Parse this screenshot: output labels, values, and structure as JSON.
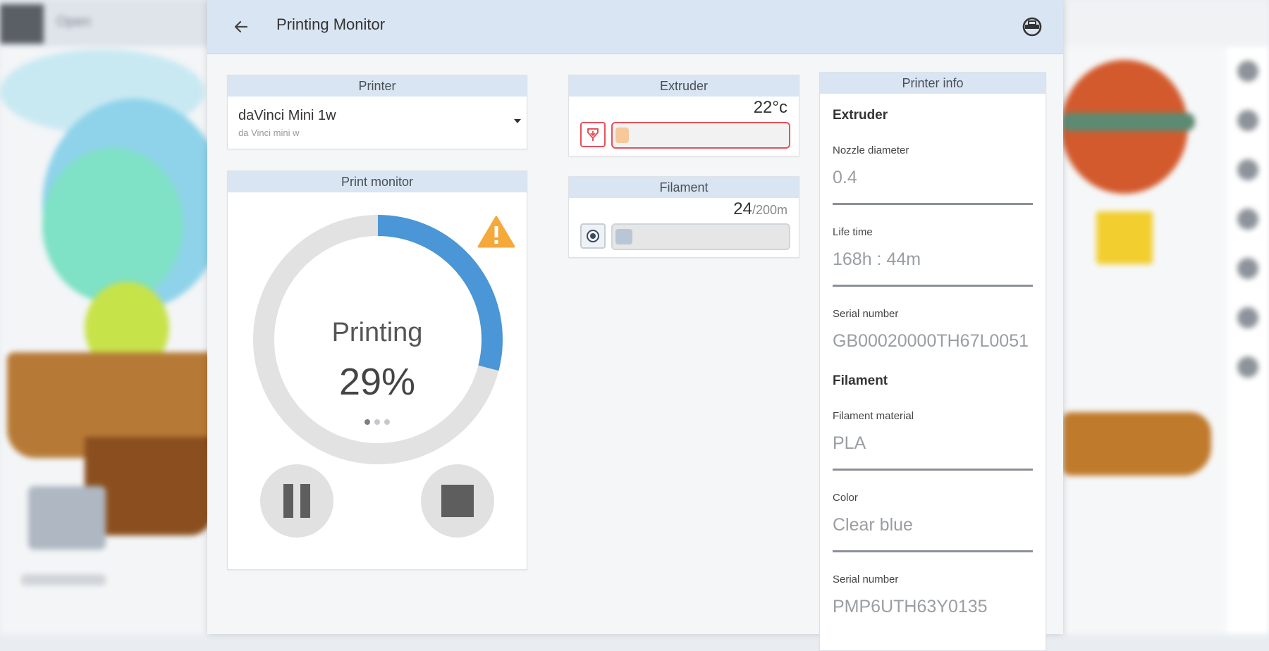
{
  "background": {
    "topbar_text": "Open"
  },
  "header": {
    "title": "Printing Monitor"
  },
  "printer_card": {
    "heading": "Printer",
    "selected_name": "daVinci Mini 1w",
    "selected_model": "da Vinci mini w"
  },
  "monitor_card": {
    "heading": "Print monitor",
    "status": "Printing",
    "percent_label": "29%",
    "progress": 0.29,
    "page_count": 3,
    "active_page": 1
  },
  "extruder_card": {
    "heading": "Extruder",
    "temperature": "22°c",
    "level": 0.08
  },
  "filament_card": {
    "heading": "Filament",
    "value": "24",
    "unit": "/200m",
    "level": 0.1
  },
  "info_card": {
    "heading": "Printer info",
    "extruder_section": "Extruder",
    "filament_section": "Filament",
    "nozzle_label": "Nozzle diameter",
    "nozzle_value": "0.4",
    "lifetime_label": "Life time",
    "lifetime_value": "168h : 44m",
    "printer_serial_label": "Serial number",
    "printer_serial_value": "GB00020000TH67L0051",
    "material_label": "Filament material",
    "material_value": "PLA",
    "color_label": "Color",
    "color_value": "Clear blue",
    "filament_serial_label": "Serial number",
    "filament_serial_value": "PMP6UTH63Y0135"
  },
  "colors": {
    "progress_accent": "#4a96d6",
    "progress_track": "#e2e2e2",
    "warning": "#f4a93a",
    "extruder_accent": "#e8505b",
    "extruder_fill": "#f7c99a",
    "filament_fill": "#b8c6d6",
    "header_bg": "#d9e5f2"
  },
  "icons": {
    "back": "arrow-left-icon",
    "header_action": "printer-icon",
    "warning": "warning-icon",
    "extruder": "heater-icon",
    "filament": "spool-icon",
    "pause": "pause-icon",
    "stop": "stop-icon"
  }
}
